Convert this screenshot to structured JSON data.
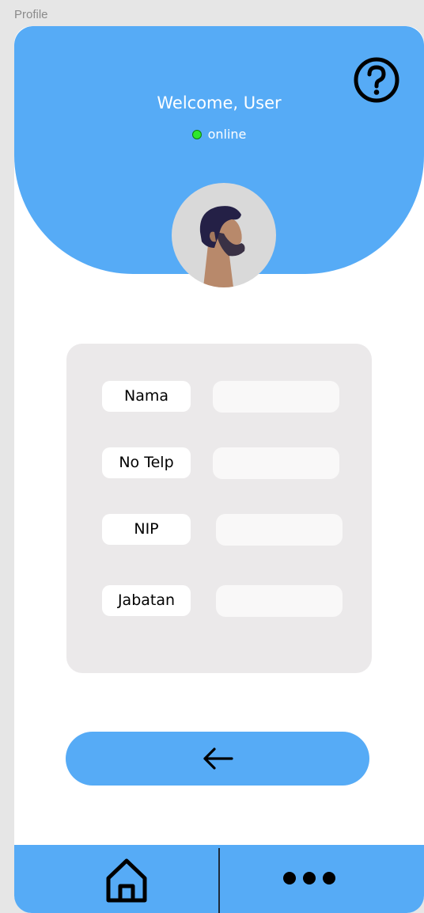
{
  "frame": {
    "title": "Profile"
  },
  "header": {
    "welcome": "Welcome, User",
    "status": "online",
    "help_icon": "question-circle-icon",
    "colors": {
      "background": "#56abf6",
      "status_dot": "#2ee82e"
    }
  },
  "avatar": {
    "icon": "user-avatar-illustration"
  },
  "form": {
    "fields": [
      {
        "label": "Nama",
        "value": ""
      },
      {
        "label": "No Telp",
        "value": ""
      },
      {
        "label": "NIP",
        "value": ""
      },
      {
        "label": "Jabatan",
        "value": ""
      }
    ]
  },
  "back_button": {
    "icon": "arrow-left-icon"
  },
  "bottom_nav": {
    "items": [
      {
        "icon": "home-icon"
      },
      {
        "icon": "more-dots-icon"
      }
    ]
  }
}
